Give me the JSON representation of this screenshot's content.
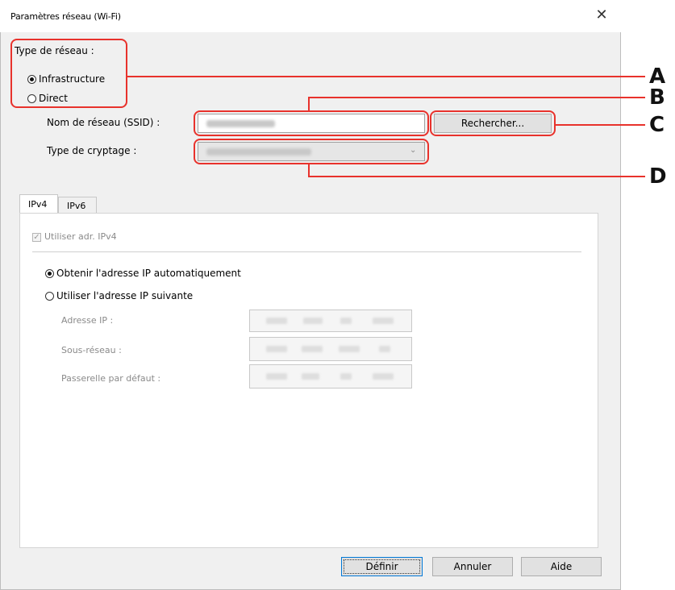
{
  "window": {
    "title": "Paramètres réseau (Wi-Fi)",
    "close_glyph": "✕"
  },
  "network_type": {
    "label": "Type de réseau :",
    "options": [
      {
        "label": "Infrastructure",
        "selected": true
      },
      {
        "label": "Direct",
        "selected": false
      }
    ]
  },
  "ssid": {
    "label": "Nom de réseau (SSID) :",
    "search_button": "Rechercher..."
  },
  "encryption": {
    "label": "Type de cryptage :"
  },
  "callouts": [
    "A",
    "B",
    "C",
    "D"
  ],
  "tabs": [
    {
      "label": "IPv4",
      "active": true
    },
    {
      "label": "IPv6",
      "active": false
    }
  ],
  "ipv4": {
    "use_checkbox_label": "Utiliser adr. IPv4",
    "use_checked": true,
    "auto_option": "Obtenir l'adresse IP automatiquement",
    "manual_option": "Utiliser l'adresse IP suivante",
    "auto_selected": true,
    "fields": [
      {
        "label": "Adresse IP :"
      },
      {
        "label": "Sous-réseau :"
      },
      {
        "label": "Passerelle par défaut :"
      }
    ]
  },
  "buttons": {
    "define": "Définir",
    "cancel": "Annuler",
    "help": "Aide"
  },
  "colors": {
    "annotation_red": "#e8322c",
    "dialog_bg": "#f0f0f0"
  }
}
